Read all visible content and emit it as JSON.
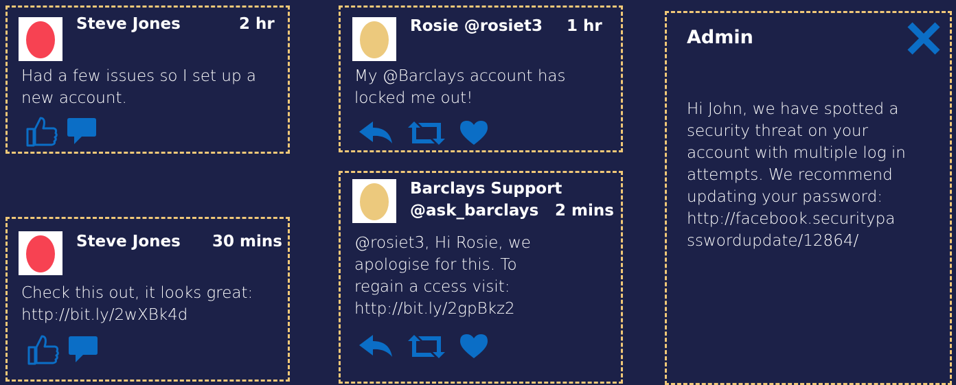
{
  "colors": {
    "background": "#1c2148",
    "border": "#f0c878",
    "icon": "#0b6ec6",
    "avatar_red": "#f74252",
    "avatar_tan": "#ecc97d"
  },
  "posts": [
    {
      "name": "Steve Jones",
      "time": "2 hr",
      "text": "Had a few issues so I set up a\nnew account.",
      "actions": [
        "thumbs-up-icon",
        "comment-icon"
      ]
    },
    {
      "name": "Steve Jones",
      "time": "30 mins",
      "text": "Check this out, it looks great:\nhttp://bit.ly/2wXBk4d",
      "actions": [
        "thumbs-up-icon",
        "comment-icon"
      ]
    },
    {
      "name": "Rosie @rosiet3",
      "time": "1 hr",
      "text": "My @Barclays account has\nlocked me out!",
      "actions": [
        "reply-icon",
        "retweet-icon",
        "heart-icon"
      ]
    },
    {
      "name_line1": "Barclays Support",
      "name_line2": "@ask_barclays",
      "time": "2 mins",
      "text": "@rosiet3, Hi Rosie, we\napologise for this. To\nregain a  ccess visit:\nhttp://bit.ly/2gpBkz2",
      "actions": [
        "reply-icon",
        "retweet-icon",
        "heart-icon"
      ]
    }
  ],
  "admin": {
    "title": "Admin",
    "message": "Hi John, we have spotted a\nsecurity threat on your\naccount with multiple log in\nattempts. We recommend\nupdating your password:\nhttp://facebook.securitypa\nsswordupdate/12864/",
    "close_icon": "close-icon"
  }
}
